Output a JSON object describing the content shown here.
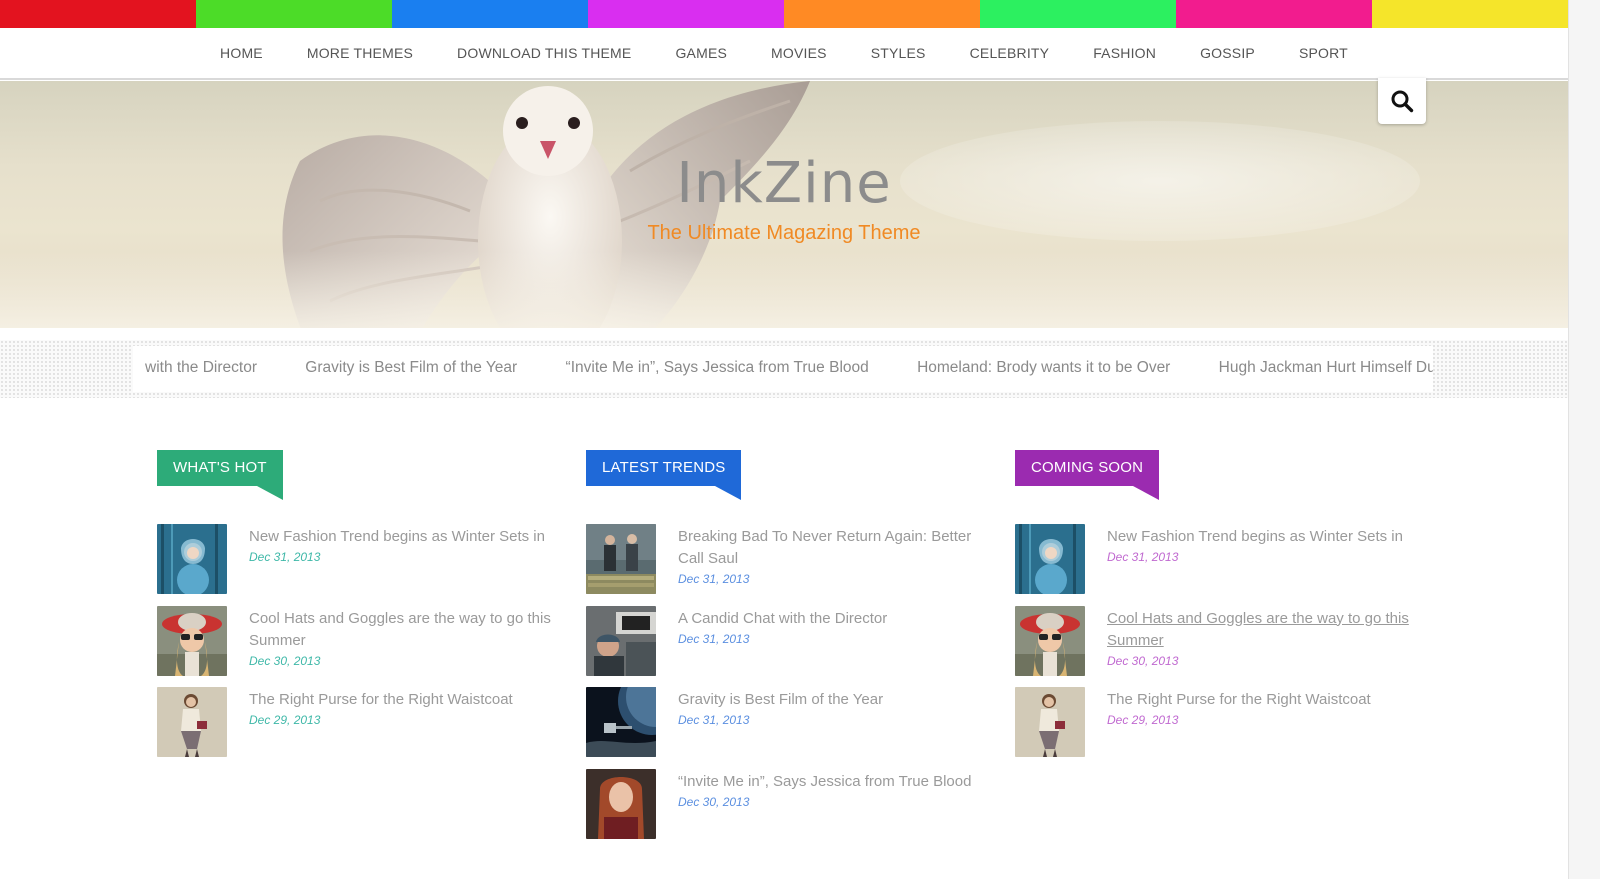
{
  "stripe_colors": [
    "#e3131f",
    "#4cdc28",
    "#1a7ff0",
    "#d92ef0",
    "#ff8a24",
    "#2cf060",
    "#f21c8e",
    "#f5e52a"
  ],
  "nav": [
    "HOME",
    "MORE THEMES",
    "DOWNLOAD THIS THEME",
    "GAMES",
    "MOVIES",
    "STYLES",
    "CELEBRITY",
    "FASHION",
    "GOSSIP",
    "SPORT"
  ],
  "hero": {
    "title": "InkZine",
    "tagline": "The Ultimate Magazing Theme"
  },
  "search": {
    "icon": "search-icon"
  },
  "ticker": [
    "with the Director",
    "Gravity is Best Film of the Year",
    "“Invite Me in”, Says Jessica from True Blood",
    "Homeland: Brody wants it to be Over",
    "Hugh Jackman Hurt Himself During"
  ],
  "columns": [
    {
      "heading": "WHAT'S HOT",
      "color": "#2dab79",
      "date_color": "#3fb8a8",
      "items": [
        {
          "title_lines": [
            "New Fashion Trend begins as Winter Sets in"
          ],
          "date": "Dec 31, 2013",
          "thumb": "blue-forest-portrait"
        },
        {
          "title_lines": [
            "Cool Hats and Goggles are the way to go this",
            "Summer"
          ],
          "date": "Dec 30, 2013",
          "thumb": "red-hat-goggles"
        },
        {
          "title_lines": [
            "The Right Purse for the Right Waistcoat"
          ],
          "date": "Dec 29, 2013",
          "thumb": "waistcoat-model"
        }
      ]
    },
    {
      "heading": "LATEST TRENDS",
      "color": "#1f69d8",
      "date_color": "#5b8fe0",
      "items": [
        {
          "title_lines": [
            "Breaking Bad To Never Return Again: Better",
            "Call Saul"
          ],
          "date": "Dec 31, 2013",
          "thumb": "two-men-money"
        },
        {
          "title_lines": [
            "A Candid Chat with the Director"
          ],
          "date": "Dec 31, 2013",
          "thumb": "director-camera"
        },
        {
          "title_lines": [
            "Gravity is Best Film of the Year"
          ],
          "date": "Dec 31, 2013",
          "thumb": "space-scene"
        },
        {
          "title_lines": [
            "“Invite Me in”, Says Jessica from True Blood"
          ],
          "date": "Dec 30, 2013",
          "thumb": "redhead-woman"
        }
      ]
    },
    {
      "heading": "COMING SOON",
      "color": "#9b2bb0",
      "date_color": "#c069d0",
      "items": [
        {
          "title_lines": [
            "New Fashion Trend begins as Winter Sets in"
          ],
          "date": "Dec 31, 2013",
          "thumb": "blue-forest-portrait"
        },
        {
          "title_lines": [
            "Cool Hats and Goggles are the way to go this",
            "Summer"
          ],
          "date": "Dec 30, 2013",
          "thumb": "red-hat-goggles",
          "underline": true
        },
        {
          "title_lines": [
            "The Right Purse for the Right Waistcoat"
          ],
          "date": "Dec 29, 2013",
          "thumb": "waistcoat-model"
        }
      ]
    }
  ]
}
